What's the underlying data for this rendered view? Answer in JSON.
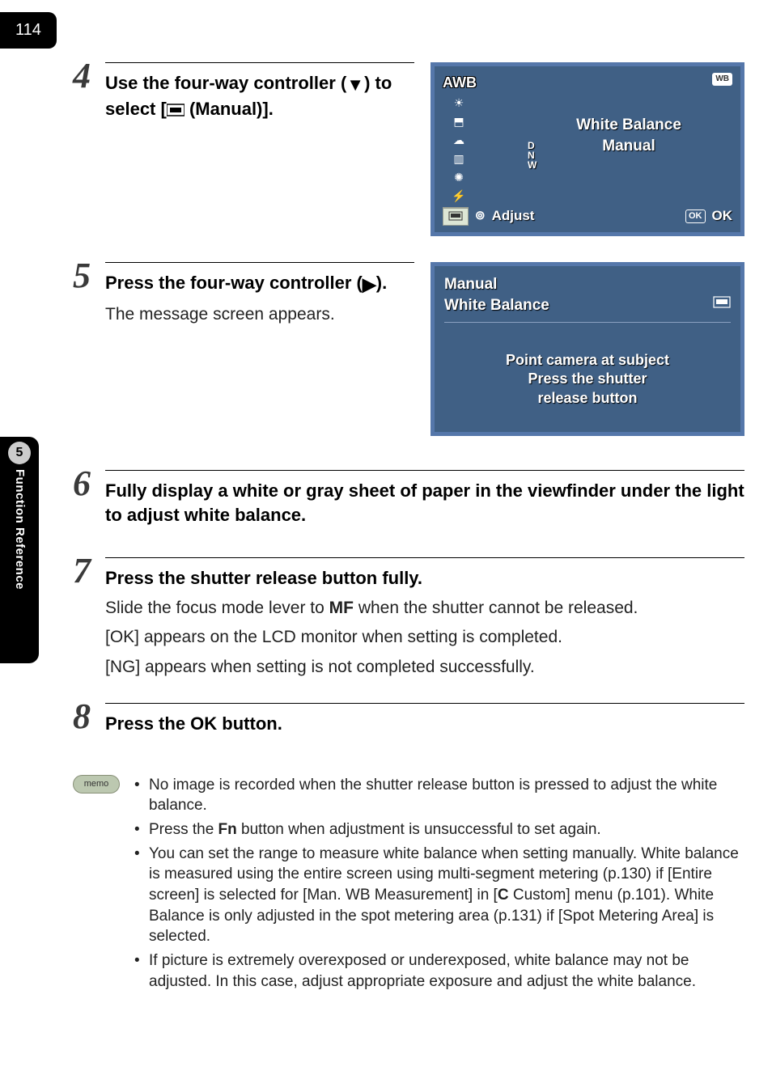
{
  "page_number": "114",
  "side_tab": {
    "chapter_num": "5",
    "chapter_title": "Function Reference"
  },
  "step4": {
    "num": "4",
    "title_before": "Use the four-way controller (",
    "title_arrow": "▼",
    "title_after": ") to select [",
    "title_icon_name": "manual-wb-icon",
    "title_end": " (Manual)].",
    "screen": {
      "wb_badge": "WB",
      "items": {
        "awb": "AWB"
      },
      "dnw": "D\nN\nW",
      "center_line1": "White Balance",
      "center_line2": "Manual",
      "bottom_adjust": "Adjust",
      "bottom_ok_badge": "OK",
      "bottom_ok": "OK"
    }
  },
  "step5": {
    "num": "5",
    "title_before": "Press the four-way controller (",
    "title_arrow": "▶",
    "title_after": ").",
    "body": "The message screen appears.",
    "screen": {
      "header_line1": "Manual",
      "header_line2": "White Balance",
      "msg_line1": "Point camera at subject",
      "msg_line2": "Press the shutter",
      "msg_line3": "release button"
    }
  },
  "step6": {
    "num": "6",
    "title": "Fully display a white or gray sheet of paper in the viewfinder under the light to adjust white balance."
  },
  "step7": {
    "num": "7",
    "title": "Press the shutter release button fully.",
    "line1_before": "Slide the focus mode lever to ",
    "line1_mf": "MF",
    "line1_after": " when the shutter cannot be released.",
    "line2": "[OK] appears on the LCD monitor when setting is completed.",
    "line3": "[NG] appears when setting is not completed successfully."
  },
  "step8": {
    "num": "8",
    "title_before": "Press the ",
    "title_btn": "OK",
    "title_after": " button."
  },
  "memo": {
    "label": "memo",
    "items": [
      {
        "text": "No image is recorded when the shutter release button is pressed to adjust the white balance."
      },
      {
        "before": "Press the ",
        "bold": "Fn",
        "after": " button when adjustment is unsuccessful to set again."
      },
      {
        "before": "You can set the range to measure white balance when setting manually. White balance is measured using the entire screen using multi-segment metering (p.130) if [Entire screen] is selected for [Man. WB Measurement] in [",
        "bold": "C",
        "after": " Custom] menu (p.101). White Balance is only adjusted in the spot metering area (p.131) if [Spot Metering Area] is selected."
      },
      {
        "text": "If picture is extremely overexposed or underexposed, white balance may not be adjusted. In this case, adjust appropriate exposure and adjust the white balance."
      }
    ]
  }
}
